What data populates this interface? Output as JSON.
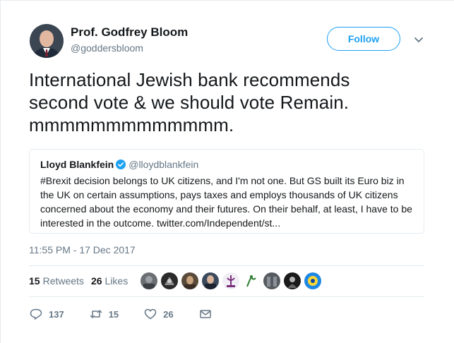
{
  "author": {
    "name": "Prof. Godfrey Bloom",
    "handle": "@goddersbloom"
  },
  "follow_label": "Follow",
  "tweet_lines": [
    "International Jewish bank recommends",
    "second vote & we should vote Remain.",
    "mmmmmmmmmmmmm."
  ],
  "quote": {
    "name": "Lloyd Blankfein",
    "handle": "@lloydblankfein",
    "lines": [
      "#Brexit decision belongs to UK citizens, and I'm not one. But GS built its Euro biz in",
      "the UK on certain assumptions, pays taxes and employs thousands of UK citizens",
      "concerned about the economy and their futures. On their behalf, at least, I have to be",
      "interested in the outcome. twitter.com/Independent/st..."
    ]
  },
  "timestamp": "11:55 PM - 17 Dec 2017",
  "stats": {
    "retweets_count": "15",
    "retweets_label": "Retweets",
    "likes_count": "26",
    "likes_label": "Likes"
  },
  "actions": {
    "replies": "137",
    "retweets": "15",
    "likes": "26"
  },
  "colors": {
    "accent": "#1da1f2",
    "secondary_text": "#657786",
    "border": "#e6ecf0"
  },
  "icons": [
    "chevron-down-icon",
    "verified-badge-icon",
    "reply-icon",
    "retweet-icon",
    "heart-icon",
    "message-icon"
  ]
}
